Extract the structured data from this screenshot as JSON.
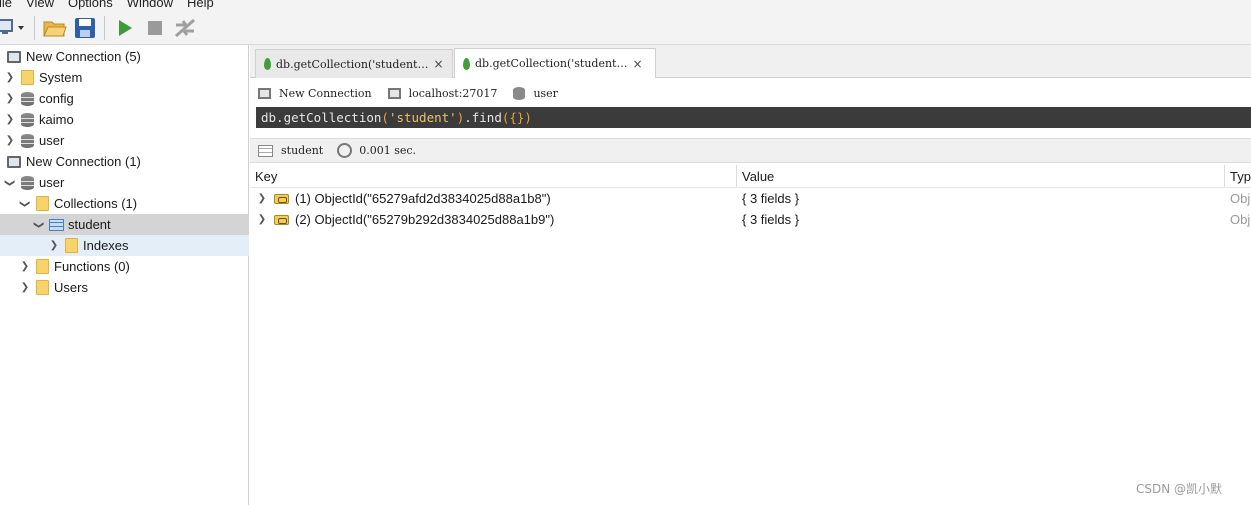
{
  "menu": [
    "ile",
    "View",
    "Options",
    "Window",
    "Help"
  ],
  "toolbar": {
    "connect_icon": "connect-icon",
    "open_icon": "folder-open-icon",
    "save_icon": "save-icon",
    "run_icon": "play-icon",
    "stop_icon": "stop-icon",
    "format_icon": "format-icon"
  },
  "tree": {
    "items": [
      {
        "label": "New Connection (5)",
        "icon": "monitor-icon"
      },
      {
        "label": "System",
        "icon": "folder-icon"
      },
      {
        "label": "config",
        "icon": "database-icon"
      },
      {
        "label": "kaimo",
        "icon": "database-icon"
      },
      {
        "label": "user",
        "icon": "database-icon"
      },
      {
        "label": "New Connection (1)",
        "icon": "monitor-icon"
      },
      {
        "label": "user",
        "icon": "database-icon"
      },
      {
        "label": "Collections (1)",
        "icon": "folder-icon"
      },
      {
        "label": "student",
        "icon": "collection-icon"
      },
      {
        "label": "Indexes",
        "icon": "folder-icon"
      },
      {
        "label": "Functions (0)",
        "icon": "folder-icon"
      },
      {
        "label": "Users",
        "icon": "folder-icon"
      }
    ]
  },
  "tabs": [
    {
      "label": "db.getCollection('student…",
      "close": "×"
    },
    {
      "label": "db.getCollection('student…",
      "close": "×"
    }
  ],
  "info": {
    "connection": "New Connection",
    "host": "localhost:27017",
    "database": "user"
  },
  "query": {
    "prefix": "db.getCollection",
    "open": "(",
    "arg": "'student'",
    "close": ")",
    "method": ".find",
    "args": "({})"
  },
  "result": {
    "collection": "student",
    "time": "0.001 sec."
  },
  "columns": {
    "key": "Key",
    "value": "Value",
    "type": "Typ"
  },
  "rows": [
    {
      "key": "(1) ObjectId(\"65279afd2d3834025d88a1b8\")",
      "value": "{ 3 fields }",
      "type": "Obj"
    },
    {
      "key": "(2) ObjectId(\"65279b292d3834025d88a1b9\")",
      "value": "{ 3 fields }",
      "type": "Obj"
    }
  ],
  "watermark": "CSDN @凯小默"
}
